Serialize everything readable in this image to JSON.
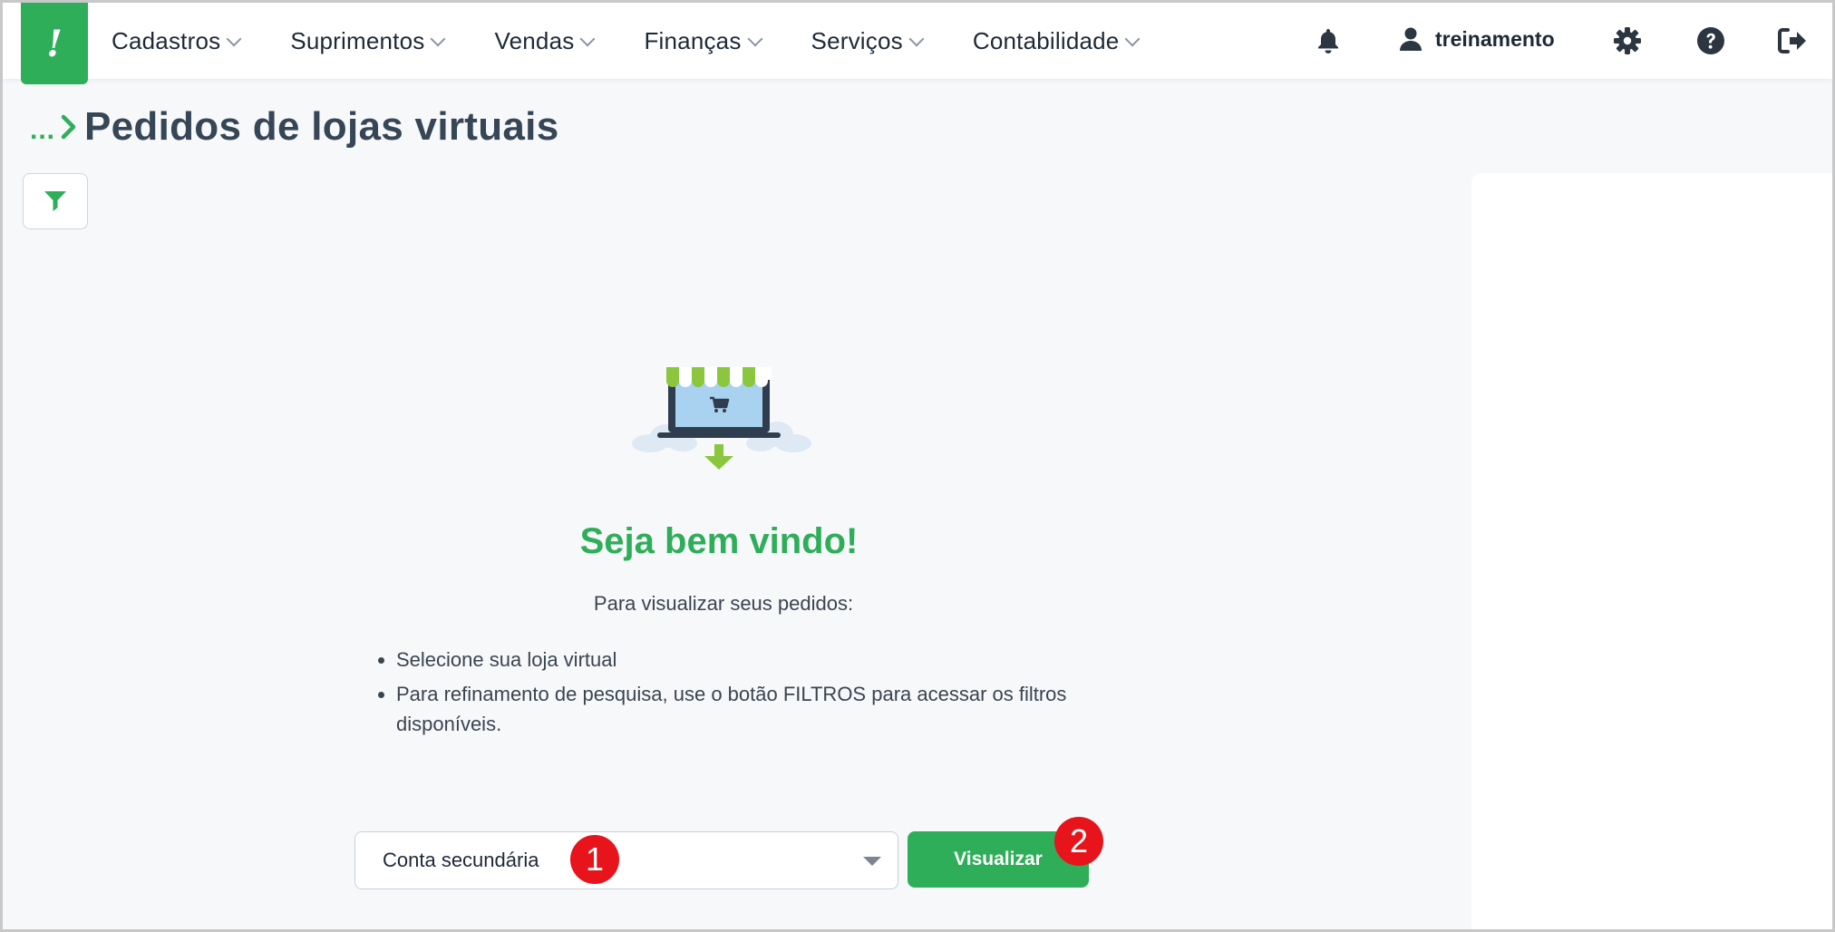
{
  "nav": {
    "logo_glyph": "!",
    "menu": [
      {
        "label": "Cadastros"
      },
      {
        "label": "Suprimentos"
      },
      {
        "label": "Vendas"
      },
      {
        "label": "Finanças"
      },
      {
        "label": "Serviços"
      },
      {
        "label": "Contabilidade"
      }
    ],
    "icons": [
      "bell-icon",
      "user-icon",
      "gear-icon",
      "help-icon",
      "logout-icon"
    ],
    "username": "treinamento"
  },
  "breadcrumb": {
    "ellipsis": "...",
    "separator_icon": "chevron-right-icon"
  },
  "page": {
    "title": "Pedidos de lojas virtuais"
  },
  "toolbar": {
    "filter_icon": "filter-icon"
  },
  "welcome": {
    "illustration_icon": "online-store-icon",
    "title": "Seja bem vindo!",
    "subtitle": "Para visualizar seus pedidos:",
    "tips": [
      "Selecione sua loja virtual",
      "Para refinamento de pesquisa, use o botão FILTROS para acessar os filtros disponíveis."
    ]
  },
  "store_select": {
    "value": "Conta secundária",
    "caret_icon": "caret-down-icon"
  },
  "view_button": {
    "label": "Visualizar"
  },
  "annotations": {
    "step1": "1",
    "step2": "2"
  },
  "colors": {
    "accent": "#2fae5a",
    "annotation": "#e8141c",
    "title": "#364656"
  }
}
